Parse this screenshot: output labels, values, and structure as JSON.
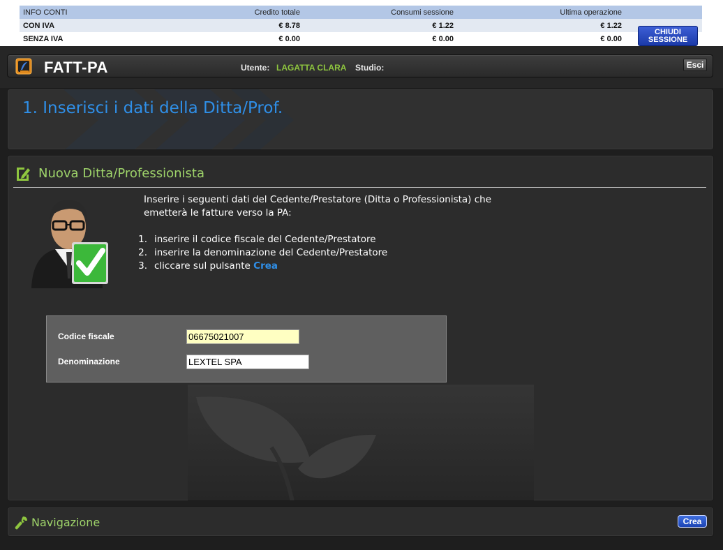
{
  "info": {
    "headers": [
      "INFO CONTI",
      "Credito totale",
      "Consumi sessione",
      "Ultima operazione"
    ],
    "rows": [
      {
        "label": "CON IVA",
        "credit": "€  8.78",
        "session": "€ 1.22",
        "last": "€ 1.22"
      },
      {
        "label": "SENZA IVA",
        "credit": "€  0.00",
        "session": "€ 0.00",
        "last": "€ 0.00"
      }
    ],
    "close_button": {
      "line1": "CHIUDI",
      "line2": "SESSIONE"
    }
  },
  "header": {
    "app_title": "FATT-PA",
    "user_label": "Utente:",
    "user_name": "LAGATTA CLARA",
    "studio_label": "Studio:",
    "exit_label": "Esci"
  },
  "step": {
    "title": "1. Inserisci i dati della Ditta/Prof."
  },
  "section": {
    "title": "Nuova Ditta/Professionista",
    "intro": "Inserire i seguenti dati del Cedente/Prestatore (Ditta o Professionista) che emetterà le fatture verso la PA:",
    "steps": [
      {
        "num": "1.",
        "text": "inserire il codice fiscale del Cedente/Prestatore"
      },
      {
        "num": "2.",
        "text": "inserire la denominazione del Cedente/Prestatore"
      },
      {
        "num": "3.",
        "text": "cliccare sul pulsante ",
        "highlight": "Crea"
      }
    ]
  },
  "form": {
    "codice_fiscale_label": "Codice fiscale",
    "codice_fiscale_value": "06675021007",
    "denominazione_label": "Denominazione",
    "denominazione_value": "LEXTEL SPA"
  },
  "navigation": {
    "title": "Navigazione",
    "crea_label": "Crea"
  },
  "colors": {
    "accent_blue": "#2f8fe8",
    "accent_green": "#9ed36a",
    "user_green": "#8fc63f",
    "input_highlight": "#ffffc2"
  },
  "icons": {
    "logo": "fattpa-logo-icon",
    "section": "edit-document-icon",
    "avatar": "user-approved-icon",
    "navigation": "wrench-icon"
  }
}
